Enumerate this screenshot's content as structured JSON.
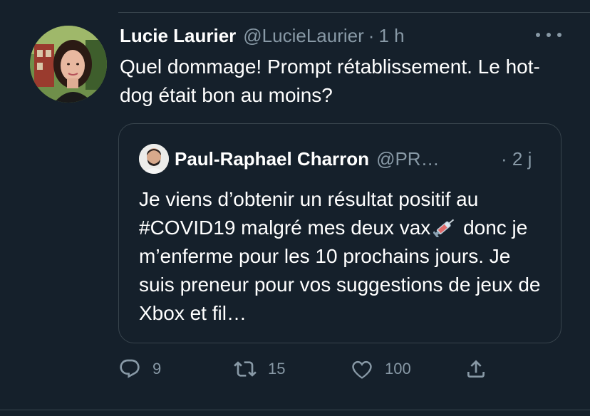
{
  "tweet": {
    "author_name": "Lucie Laurier",
    "author_handle": "@LucieLaurier",
    "separator": "·",
    "time": "1 h",
    "text": "Quel dommage! Prompt rétablissement. Le hot-dog était bon au moins?"
  },
  "quoted_tweet": {
    "author_name": "Paul-Raphael Charron",
    "author_handle": "@PR…",
    "time": "· 2 j",
    "text": "Je viens d’obtenir un résultat positif au #COVID19 malgré mes deux vax",
    "text_after_emoji": "donc je m’enferme pour les 10 prochains jours. Je suis preneur pour vos suggestions de jeux de Xbox et fil…"
  },
  "actions": {
    "reply_count": "9",
    "retweet_count": "15",
    "like_count": "100"
  },
  "icons": {
    "more": "more-dots-icon",
    "reply": "reply-icon",
    "retweet": "retweet-icon",
    "like": "heart-icon",
    "share": "share-icon",
    "emoji": "syringe-emoji-icon"
  },
  "colors": {
    "background": "#15202b",
    "secondary_text": "#8899a6",
    "border": "#38444d"
  }
}
